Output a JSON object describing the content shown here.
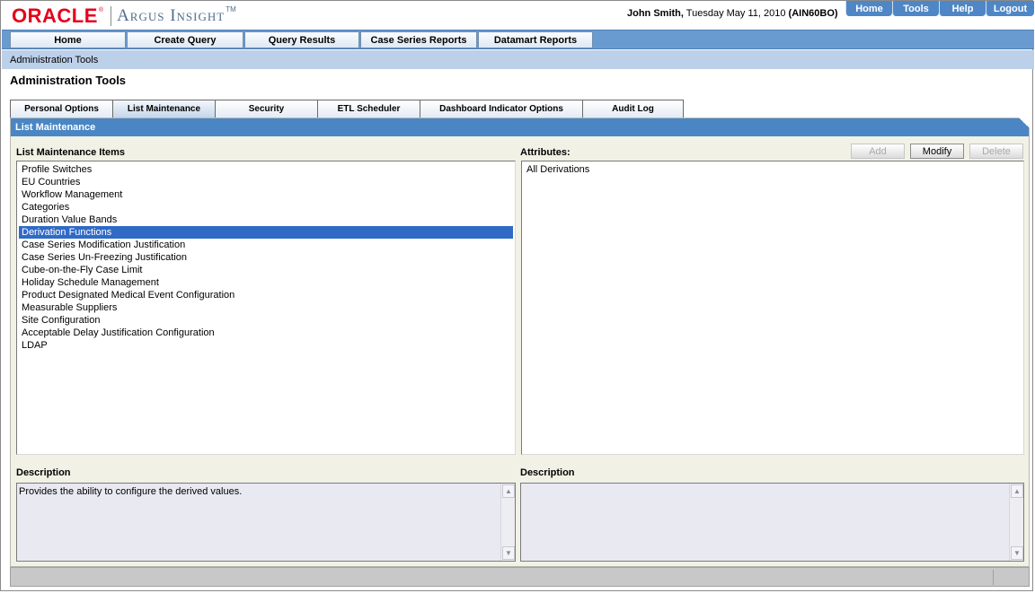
{
  "brand": {
    "oracle": "ORACLE",
    "reg": "®",
    "product": "Argus Insight",
    "tm": "TM"
  },
  "user": {
    "name": "John Smith,",
    "date": " Tuesday May 11, 2010 ",
    "code": "(AIN60BO)"
  },
  "toplinks": [
    "Home",
    "Tools",
    "Help",
    "Logout"
  ],
  "nav": [
    "Home",
    "Create Query",
    "Query Results",
    "Case Series Reports",
    "Datamart Reports"
  ],
  "breadcrumb": "Administration Tools",
  "page_title": "Administration Tools",
  "tabs": [
    "Personal Options",
    "List Maintenance",
    "Security",
    "ETL Scheduler",
    "Dashboard Indicator Options",
    "Audit Log"
  ],
  "active_tab": "List Maintenance",
  "panel": {
    "title": "List Maintenance",
    "items_label": "List Maintenance Items",
    "attributes_label": "Attributes:",
    "buttons": {
      "add": "Add",
      "modify": "Modify",
      "delete": "Delete"
    },
    "items": [
      "Profile Switches",
      "EU Countries",
      "Workflow Management",
      "Categories",
      "Duration Value Bands",
      "Derivation Functions",
      "Case Series Modification Justification",
      "Case Series Un-Freezing Justification",
      "Cube-on-the-Fly Case Limit",
      "Holiday Schedule Management",
      "Product Designated Medical Event Configuration",
      "Measurable Suppliers",
      "Site Configuration",
      "Acceptable Delay Justification Configuration",
      "LDAP"
    ],
    "selected_item": "Derivation Functions",
    "attributes": [
      "All Derivations"
    ],
    "left_description_label": "Description",
    "left_description": "Provides the ability to configure the derived values.",
    "right_description_label": "Description",
    "right_description": ""
  },
  "colors": {
    "nav_bar": "#6a9bd0",
    "panel_header": "#4a86c4",
    "selection": "#316ac5",
    "oracle_red": "#e5001a"
  }
}
